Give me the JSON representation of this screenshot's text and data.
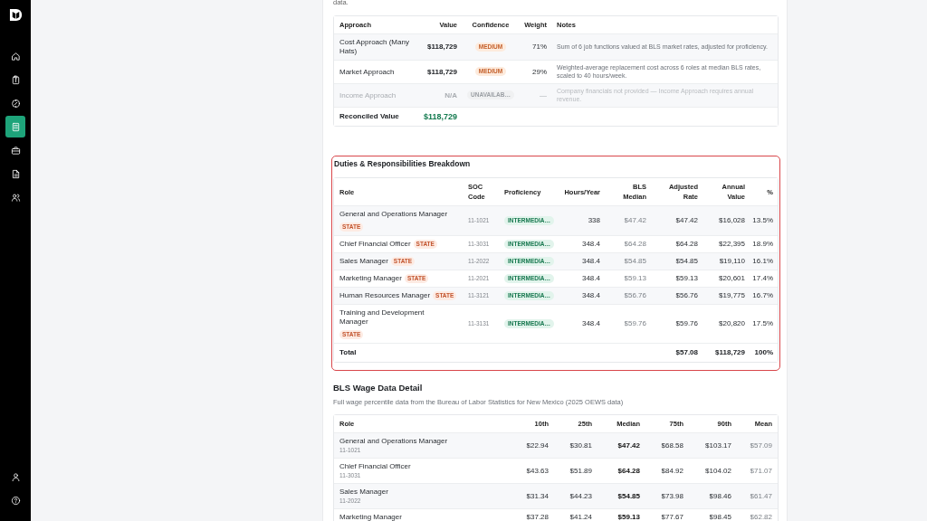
{
  "sidebar": {
    "items": [
      {
        "selected": false
      },
      {
        "selected": false
      },
      {
        "selected": false
      },
      {
        "selected": true
      },
      {
        "selected": false
      },
      {
        "selected": false
      },
      {
        "selected": false
      }
    ],
    "footer_items": [
      {
        "selected": false
      },
      {
        "selected": false
      }
    ]
  },
  "intro_tail": "data.",
  "approaches": {
    "columns": [
      "Approach",
      "Value",
      "Confidence",
      "Weight",
      "Notes"
    ],
    "rows": [
      {
        "approach": "Cost Approach (Many Hats)",
        "value": "$118,729",
        "confidence": "MEDIUM",
        "weight": "71%",
        "notes": "Sum of 6 job functions valued at BLS market rates, adjusted for proficiency.",
        "disabled": false
      },
      {
        "approach": "Market Approach",
        "value": "$118,729",
        "confidence": "MEDIUM",
        "weight": "29%",
        "notes": "Weighted-average replacement cost across 6 roles at median BLS rates, scaled to 40 hours/week.",
        "disabled": false
      },
      {
        "approach": "Income Approach",
        "value": "N/A",
        "confidence": "UNAVAILAB…",
        "weight": "—",
        "notes": "Company financials not provided — Income Approach requires annual revenue.",
        "disabled": true
      }
    ],
    "total": {
      "label": "Reconciled Value",
      "value": "$118,729"
    }
  },
  "duties": {
    "title": "Duties & Responsibilities Breakdown",
    "highlighted": true,
    "columns": [
      "Role",
      "SOC Code",
      "Proficiency",
      "Hours/Year",
      "BLS Median",
      "Adjusted Rate",
      "Annual Value",
      "%"
    ],
    "rows": [
      {
        "role": "General and Operations Manager",
        "tag": "STATE",
        "soc": "11-1021",
        "proficiency": "INTERMEDIA…",
        "hours": "338",
        "bls_median": "$47.42",
        "adjusted_rate": "$47.42",
        "annual_value": "$16,028",
        "percent": "13.5%"
      },
      {
        "role": "Chief Financial Officer",
        "tag": "STATE",
        "soc": "11-3031",
        "proficiency": "INTERMEDIA…",
        "hours": "348.4",
        "bls_median": "$64.28",
        "adjusted_rate": "$64.28",
        "annual_value": "$22,395",
        "percent": "18.9%"
      },
      {
        "role": "Sales Manager",
        "tag": "STATE",
        "soc": "11-2022",
        "proficiency": "INTERMEDIA…",
        "hours": "348.4",
        "bls_median": "$54.85",
        "adjusted_rate": "$54.85",
        "annual_value": "$19,110",
        "percent": "16.1%"
      },
      {
        "role": "Marketing Manager",
        "tag": "STATE",
        "soc": "11-2021",
        "proficiency": "INTERMEDIA…",
        "hours": "348.4",
        "bls_median": "$59.13",
        "adjusted_rate": "$59.13",
        "annual_value": "$20,601",
        "percent": "17.4%"
      },
      {
        "role": "Human Resources Manager",
        "tag": "STATE",
        "soc": "11-3121",
        "proficiency": "INTERMEDIA…",
        "hours": "348.4",
        "bls_median": "$56.76",
        "adjusted_rate": "$56.76",
        "annual_value": "$19,775",
        "percent": "16.7%"
      },
      {
        "role": "Training and Development Manager",
        "tag": "STATE",
        "soc": "11-3131",
        "proficiency": "INTERMEDIA…",
        "hours": "348.4",
        "bls_median": "$59.76",
        "adjusted_rate": "$59.76",
        "annual_value": "$20,820",
        "percent": "17.5%"
      }
    ],
    "total": {
      "label": "Total",
      "adjusted_rate": "$57.08",
      "annual_value": "$118,729",
      "percent": "100%"
    }
  },
  "bls": {
    "title": "BLS Wage Data Detail",
    "subtitle": "Full wage percentile data from the Bureau of Labor Statistics for New Mexico (2025 OEWS data)",
    "columns": [
      "Role",
      "10th",
      "25th",
      "Median",
      "75th",
      "90th",
      "Mean"
    ],
    "rows": [
      {
        "role": "General and Operations Manager",
        "soc": "11-1021",
        "values": [
          "$22.94",
          "$30.81",
          "$47.42",
          "$68.58",
          "$103.17",
          "$57.09"
        ]
      },
      {
        "role": "Chief Financial Officer",
        "soc": "11-3031",
        "values": [
          "$43.63",
          "$51.89",
          "$64.28",
          "$84.92",
          "$104.02",
          "$71.07"
        ]
      },
      {
        "role": "Sales Manager",
        "soc": "11-2022",
        "values": [
          "$31.34",
          "$44.23",
          "$54.85",
          "$73.98",
          "$98.46",
          "$61.47"
        ]
      },
      {
        "role": "Marketing Manager",
        "values": [
          "$37.28",
          "$41.24",
          "$59.13",
          "$77.67",
          "$98.45",
          "$62.82"
        ]
      }
    ]
  }
}
